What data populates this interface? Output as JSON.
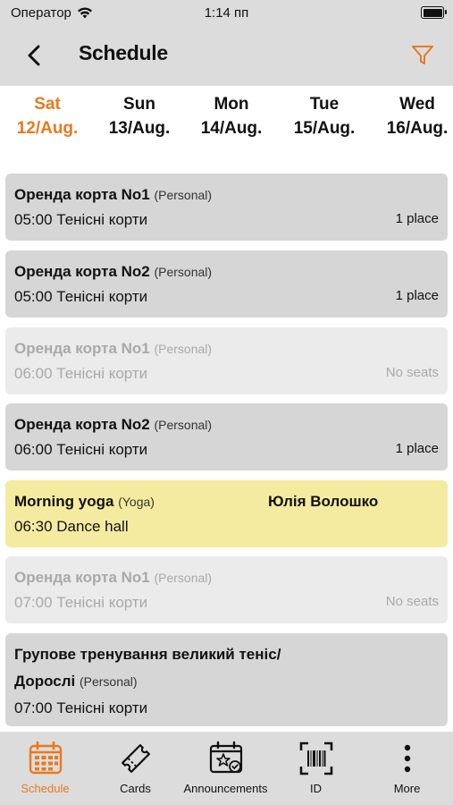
{
  "status_bar": {
    "carrier": "Оператор",
    "time": "1:14 пп"
  },
  "nav": {
    "title": "Schedule"
  },
  "days": [
    {
      "name": "Sat",
      "date": "12/Aug.",
      "selected": true
    },
    {
      "name": "Sun",
      "date": "13/Aug."
    },
    {
      "name": "Mon",
      "date": "14/Aug."
    },
    {
      "name": "Tue",
      "date": "15/Aug."
    },
    {
      "name": "Wed",
      "date": "16/Aug."
    }
  ],
  "classes": [
    {
      "title": "Оренда корта No1",
      "kind": "(Personal)",
      "time": "05:00 Тенісні корти",
      "seats": "1 place"
    },
    {
      "title": "Оренда корта No2",
      "kind": "(Personal)",
      "time": "05:00 Тенісні корти",
      "seats": "1 place"
    },
    {
      "title": "Оренда корта No1",
      "kind": "(Personal)",
      "time": "06:00 Тенісні корти",
      "seats": "No seats"
    },
    {
      "title": "Оренда корта No2",
      "kind": "(Personal)",
      "time": "06:00 Тенісні корти",
      "seats": "1 place"
    },
    {
      "title": "Morning yoga",
      "kind": "(Yoga)",
      "trainer": "Юлія Волошко",
      "time": "06:30 Dance hall"
    },
    {
      "title": "Оренда корта No1",
      "kind": "(Personal)",
      "time": "07:00 Тенісні корти",
      "seats": "No seats"
    },
    {
      "title_line1": "Групове тренування великий теніс/",
      "title_line2": "Дорослі",
      "kind": "(Personal)",
      "time": "07:00 Тенісні корти"
    }
  ],
  "tabs": [
    {
      "label": "Schedule",
      "icon": "calendar-icon",
      "active": true
    },
    {
      "label": "Cards",
      "icon": "ticket-icon"
    },
    {
      "label": "Announcements",
      "icon": "announcement-calendar-icon"
    },
    {
      "label": "ID",
      "icon": "barcode-scan-icon"
    },
    {
      "label": "More",
      "icon": "more-vertical-icon"
    }
  ],
  "colors": {
    "accent": "#e8791f",
    "bar_bg": "#dcdcdc",
    "card_bg": "#d6d6d6",
    "card_disabled": "#ebebeb",
    "card_highlight": "#f5eba0"
  }
}
